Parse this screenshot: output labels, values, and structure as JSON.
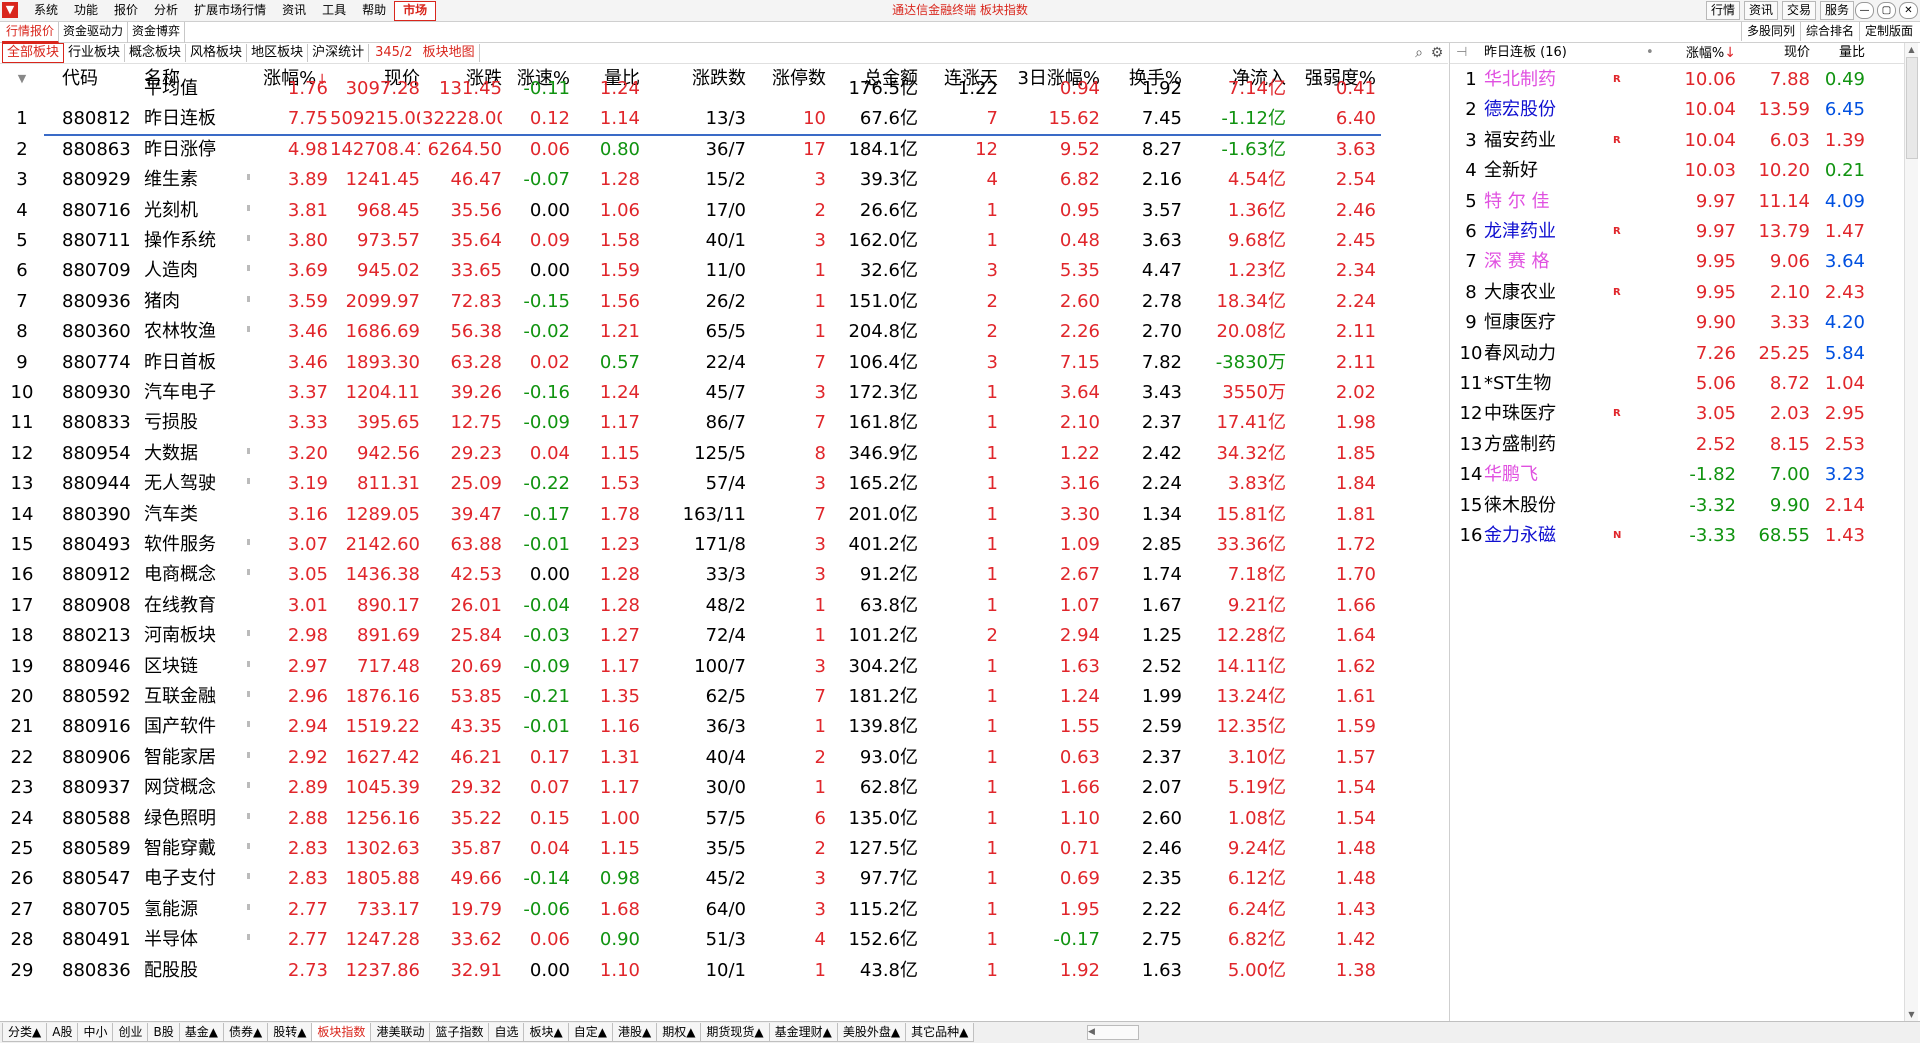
{
  "menubar": {
    "logo": "▼",
    "menus": [
      "系统",
      "功能",
      "报价",
      "分析",
      "扩展市场行情",
      "资讯",
      "工具",
      "帮助",
      "市场"
    ],
    "title": "通达信金融终端  板块指数",
    "right_buttons": [
      "行情",
      "资讯",
      "交易",
      "服务"
    ],
    "window_controls": [
      "—",
      "▢",
      "✕"
    ]
  },
  "row2": {
    "tabs": [
      "行情报价",
      "资金驱动力",
      "资金博弈"
    ],
    "right_tabs": [
      "多股同列",
      "综合排名",
      "定制版面"
    ]
  },
  "row3": {
    "tabs": [
      "全部板块",
      "行业板块",
      "概念板块",
      "风格板块",
      "地区板块",
      "沪深统计"
    ],
    "count": "345/2",
    "map_tab": "板块地图"
  },
  "table": {
    "headers": {
      "sort": "▼",
      "code": "代码",
      "name": "名称",
      "change_pct": "涨幅%",
      "sort_arrow": "↓",
      "price": "现价",
      "change": "涨跌",
      "speed": "涨速%",
      "vol_ratio": "量比",
      "up_down": "涨跌数",
      "limit_up": "涨停数",
      "amount": "总金额",
      "streak": "连涨天",
      "three_day": "3日涨幅%",
      "turnover": "换手%",
      "net_inflow": "净流入",
      "strength": "强弱度%"
    },
    "avg": {
      "name": "平均值",
      "change_pct": "1.76",
      "price": "3097.28",
      "change": "131.45",
      "speed": "-0.11",
      "vol_ratio": "1.24",
      "amount": "176.5亿",
      "streak": "1.22",
      "three_day": "0.94",
      "turnover": "1.92",
      "net_inflow": "7.14亿",
      "strength": "0.41"
    },
    "rows": [
      {
        "no": "1",
        "code": "880812",
        "name": "昨日连板",
        "change_pct": "7.75",
        "price": "509215.00",
        "change": "32228.00",
        "speed": "0.12",
        "vol_ratio": "1.14",
        "up_down": "13/3",
        "limit_up": "10",
        "amount": "67.6亿",
        "streak": "7",
        "three_day": "15.62",
        "turnover": "7.45",
        "net_inflow": "-1.12亿",
        "strength": "6.40"
      },
      {
        "no": "2",
        "code": "880863",
        "name": "昨日涨停",
        "change_pct": "4.98",
        "price": "142708.41",
        "change": "6264.50",
        "speed": "0.06",
        "vol_ratio": "0.80",
        "up_down": "36/7",
        "limit_up": "17",
        "amount": "184.1亿",
        "streak": "12",
        "three_day": "9.52",
        "turnover": "8.27",
        "net_inflow": "-1.63亿",
        "strength": "3.63"
      },
      {
        "no": "3",
        "code": "880929",
        "name": "维生素",
        "change_pct": "3.89",
        "price": "1241.45",
        "change": "46.47",
        "speed": "-0.07",
        "vol_ratio": "1.28",
        "up_down": "15/2",
        "limit_up": "3",
        "amount": "39.3亿",
        "streak": "4",
        "three_day": "6.82",
        "turnover": "2.16",
        "net_inflow": "4.54亿",
        "strength": "2.54"
      },
      {
        "no": "4",
        "code": "880716",
        "name": "光刻机",
        "change_pct": "3.81",
        "price": "968.45",
        "change": "35.56",
        "speed": "0.00",
        "vol_ratio": "1.06",
        "up_down": "17/0",
        "limit_up": "2",
        "amount": "26.6亿",
        "streak": "1",
        "three_day": "0.95",
        "turnover": "3.57",
        "net_inflow": "1.36亿",
        "strength": "2.46"
      },
      {
        "no": "5",
        "code": "880711",
        "name": "操作系统",
        "change_pct": "3.80",
        "price": "973.57",
        "change": "35.64",
        "speed": "0.09",
        "vol_ratio": "1.58",
        "up_down": "40/1",
        "limit_up": "3",
        "amount": "162.0亿",
        "streak": "1",
        "three_day": "0.48",
        "turnover": "3.63",
        "net_inflow": "9.68亿",
        "strength": "2.45"
      },
      {
        "no": "6",
        "code": "880709",
        "name": "人造肉",
        "change_pct": "3.69",
        "price": "945.02",
        "change": "33.65",
        "speed": "0.00",
        "vol_ratio": "1.59",
        "up_down": "11/0",
        "limit_up": "1",
        "amount": "32.6亿",
        "streak": "3",
        "three_day": "5.35",
        "turnover": "4.47",
        "net_inflow": "1.23亿",
        "strength": "2.34"
      },
      {
        "no": "7",
        "code": "880936",
        "name": "猪肉",
        "change_pct": "3.59",
        "price": "2099.97",
        "change": "72.83",
        "speed": "-0.15",
        "vol_ratio": "1.56",
        "up_down": "26/2",
        "limit_up": "1",
        "amount": "151.0亿",
        "streak": "2",
        "three_day": "2.60",
        "turnover": "2.78",
        "net_inflow": "18.34亿",
        "strength": "2.24"
      },
      {
        "no": "8",
        "code": "880360",
        "name": "农林牧渔",
        "change_pct": "3.46",
        "price": "1686.69",
        "change": "56.38",
        "speed": "-0.02",
        "vol_ratio": "1.21",
        "up_down": "65/5",
        "limit_up": "1",
        "amount": "204.8亿",
        "streak": "2",
        "three_day": "2.26",
        "turnover": "2.70",
        "net_inflow": "20.08亿",
        "strength": "2.11"
      },
      {
        "no": "9",
        "code": "880774",
        "name": "昨日首板",
        "change_pct": "3.46",
        "price": "1893.30",
        "change": "63.28",
        "speed": "0.02",
        "vol_ratio": "0.57",
        "up_down": "22/4",
        "limit_up": "7",
        "amount": "106.4亿",
        "streak": "3",
        "three_day": "7.15",
        "turnover": "7.82",
        "net_inflow": "-3830万",
        "strength": "2.11"
      },
      {
        "no": "10",
        "code": "880930",
        "name": "汽车电子",
        "change_pct": "3.37",
        "price": "1204.11",
        "change": "39.26",
        "speed": "-0.16",
        "vol_ratio": "1.24",
        "up_down": "45/7",
        "limit_up": "3",
        "amount": "172.3亿",
        "streak": "1",
        "three_day": "3.64",
        "turnover": "3.43",
        "net_inflow": "3550万",
        "strength": "2.02"
      },
      {
        "no": "11",
        "code": "880833",
        "name": "亏损股",
        "change_pct": "3.33",
        "price": "395.65",
        "change": "12.75",
        "speed": "-0.09",
        "vol_ratio": "1.17",
        "up_down": "86/7",
        "limit_up": "7",
        "amount": "161.8亿",
        "streak": "1",
        "three_day": "2.10",
        "turnover": "2.37",
        "net_inflow": "17.41亿",
        "strength": "1.98"
      },
      {
        "no": "12",
        "code": "880954",
        "name": "大数据",
        "change_pct": "3.20",
        "price": "942.56",
        "change": "29.23",
        "speed": "0.04",
        "vol_ratio": "1.15",
        "up_down": "125/5",
        "limit_up": "8",
        "amount": "346.9亿",
        "streak": "1",
        "three_day": "1.22",
        "turnover": "2.42",
        "net_inflow": "34.32亿",
        "strength": "1.85"
      },
      {
        "no": "13",
        "code": "880944",
        "name": "无人驾驶",
        "change_pct": "3.19",
        "price": "811.31",
        "change": "25.09",
        "speed": "-0.22",
        "vol_ratio": "1.53",
        "up_down": "57/4",
        "limit_up": "3",
        "amount": "165.2亿",
        "streak": "1",
        "three_day": "3.16",
        "turnover": "2.24",
        "net_inflow": "3.83亿",
        "strength": "1.84"
      },
      {
        "no": "14",
        "code": "880390",
        "name": "汽车类",
        "change_pct": "3.16",
        "price": "1289.05",
        "change": "39.47",
        "speed": "-0.17",
        "vol_ratio": "1.78",
        "up_down": "163/11",
        "limit_up": "7",
        "amount": "201.0亿",
        "streak": "1",
        "three_day": "3.30",
        "turnover": "1.34",
        "net_inflow": "15.81亿",
        "strength": "1.81"
      },
      {
        "no": "15",
        "code": "880493",
        "name": "软件服务",
        "change_pct": "3.07",
        "price": "2142.60",
        "change": "63.88",
        "speed": "-0.01",
        "vol_ratio": "1.23",
        "up_down": "171/8",
        "limit_up": "3",
        "amount": "401.2亿",
        "streak": "1",
        "three_day": "1.09",
        "turnover": "2.85",
        "net_inflow": "33.36亿",
        "strength": "1.72"
      },
      {
        "no": "16",
        "code": "880912",
        "name": "电商概念",
        "change_pct": "3.05",
        "price": "1436.38",
        "change": "42.53",
        "speed": "0.00",
        "vol_ratio": "1.28",
        "up_down": "33/3",
        "limit_up": "3",
        "amount": "91.2亿",
        "streak": "1",
        "three_day": "2.67",
        "turnover": "1.74",
        "net_inflow": "7.18亿",
        "strength": "1.70"
      },
      {
        "no": "17",
        "code": "880908",
        "name": "在线教育",
        "change_pct": "3.01",
        "price": "890.17",
        "change": "26.01",
        "speed": "-0.04",
        "vol_ratio": "1.28",
        "up_down": "48/2",
        "limit_up": "1",
        "amount": "63.8亿",
        "streak": "1",
        "three_day": "1.07",
        "turnover": "1.67",
        "net_inflow": "9.21亿",
        "strength": "1.66"
      },
      {
        "no": "18",
        "code": "880213",
        "name": "河南板块",
        "change_pct": "2.98",
        "price": "891.69",
        "change": "25.84",
        "speed": "-0.03",
        "vol_ratio": "1.27",
        "up_down": "72/4",
        "limit_up": "1",
        "amount": "101.2亿",
        "streak": "2",
        "three_day": "2.94",
        "turnover": "1.25",
        "net_inflow": "12.28亿",
        "strength": "1.64"
      },
      {
        "no": "19",
        "code": "880946",
        "name": "区块链",
        "change_pct": "2.97",
        "price": "717.48",
        "change": "20.69",
        "speed": "-0.09",
        "vol_ratio": "1.17",
        "up_down": "100/7",
        "limit_up": "3",
        "amount": "304.2亿",
        "streak": "1",
        "three_day": "1.63",
        "turnover": "2.52",
        "net_inflow": "14.11亿",
        "strength": "1.62"
      },
      {
        "no": "20",
        "code": "880592",
        "name": "互联金融",
        "change_pct": "2.96",
        "price": "1876.16",
        "change": "53.85",
        "speed": "-0.21",
        "vol_ratio": "1.35",
        "up_down": "62/5",
        "limit_up": "7",
        "amount": "181.2亿",
        "streak": "1",
        "three_day": "1.24",
        "turnover": "1.99",
        "net_inflow": "13.24亿",
        "strength": "1.61"
      },
      {
        "no": "21",
        "code": "880916",
        "name": "国产软件",
        "change_pct": "2.94",
        "price": "1519.22",
        "change": "43.35",
        "speed": "-0.01",
        "vol_ratio": "1.16",
        "up_down": "36/3",
        "limit_up": "1",
        "amount": "139.8亿",
        "streak": "1",
        "three_day": "1.55",
        "turnover": "2.59",
        "net_inflow": "12.35亿",
        "strength": "1.59"
      },
      {
        "no": "22",
        "code": "880906",
        "name": "智能家居",
        "change_pct": "2.92",
        "price": "1627.42",
        "change": "46.21",
        "speed": "0.17",
        "vol_ratio": "1.31",
        "up_down": "40/4",
        "limit_up": "2",
        "amount": "93.0亿",
        "streak": "1",
        "three_day": "0.63",
        "turnover": "2.37",
        "net_inflow": "3.10亿",
        "strength": "1.57"
      },
      {
        "no": "23",
        "code": "880937",
        "name": "网贷概念",
        "change_pct": "2.89",
        "price": "1045.39",
        "change": "29.32",
        "speed": "0.07",
        "vol_ratio": "1.17",
        "up_down": "30/0",
        "limit_up": "1",
        "amount": "62.8亿",
        "streak": "1",
        "three_day": "1.66",
        "turnover": "2.07",
        "net_inflow": "5.19亿",
        "strength": "1.54"
      },
      {
        "no": "24",
        "code": "880588",
        "name": "绿色照明",
        "change_pct": "2.88",
        "price": "1256.16",
        "change": "35.22",
        "speed": "0.15",
        "vol_ratio": "1.00",
        "up_down": "57/5",
        "limit_up": "6",
        "amount": "135.0亿",
        "streak": "1",
        "three_day": "1.10",
        "turnover": "2.60",
        "net_inflow": "1.08亿",
        "strength": "1.54"
      },
      {
        "no": "25",
        "code": "880589",
        "name": "智能穿戴",
        "change_pct": "2.83",
        "price": "1302.63",
        "change": "35.87",
        "speed": "0.04",
        "vol_ratio": "1.15",
        "up_down": "35/5",
        "limit_up": "2",
        "amount": "127.5亿",
        "streak": "1",
        "three_day": "0.71",
        "turnover": "2.46",
        "net_inflow": "9.24亿",
        "strength": "1.48"
      },
      {
        "no": "26",
        "code": "880547",
        "name": "电子支付",
        "change_pct": "2.83",
        "price": "1805.88",
        "change": "49.66",
        "speed": "-0.14",
        "vol_ratio": "0.98",
        "up_down": "45/2",
        "limit_up": "3",
        "amount": "97.7亿",
        "streak": "1",
        "three_day": "0.69",
        "turnover": "2.35",
        "net_inflow": "6.12亿",
        "strength": "1.48"
      },
      {
        "no": "27",
        "code": "880705",
        "name": "氢能源",
        "change_pct": "2.77",
        "price": "733.17",
        "change": "19.79",
        "speed": "-0.06",
        "vol_ratio": "1.68",
        "up_down": "64/0",
        "limit_up": "3",
        "amount": "115.2亿",
        "streak": "1",
        "three_day": "1.95",
        "turnover": "2.22",
        "net_inflow": "6.24亿",
        "strength": "1.43"
      },
      {
        "no": "28",
        "code": "880491",
        "name": "半导体",
        "change_pct": "2.77",
        "price": "1247.28",
        "change": "33.62",
        "speed": "0.06",
        "vol_ratio": "0.90",
        "up_down": "51/3",
        "limit_up": "4",
        "amount": "152.6亿",
        "streak": "1",
        "three_day": "-0.17",
        "turnover": "2.75",
        "net_inflow": "6.82亿",
        "strength": "1.42"
      },
      {
        "no": "29",
        "code": "880836",
        "name": "配股股",
        "change_pct": "2.73",
        "price": "1237.86",
        "change": "32.91",
        "speed": "0.00",
        "vol_ratio": "1.10",
        "up_down": "10/1",
        "limit_up": "1",
        "amount": "43.8亿",
        "streak": "1",
        "three_day": "1.92",
        "turnover": "1.63",
        "net_inflow": "5.00亿",
        "strength": "1.38"
      }
    ]
  },
  "right_panel": {
    "pin": "⊣",
    "title": "昨日连板 (16)",
    "headers": {
      "change_pct": "涨幅%",
      "sort_arrow": "↓",
      "price": "现价",
      "vol_ratio": "量比"
    },
    "rows": [
      {
        "no": "1",
        "name": "华北制药",
        "flag": "R",
        "change_pct": "10.06",
        "price": "7.88",
        "vol_ratio": "0.49",
        "name_color": "#e050e0",
        "vr_color": "#109310"
      },
      {
        "no": "2",
        "name": "德宏股份",
        "flag": "",
        "change_pct": "10.04",
        "price": "13.59",
        "vol_ratio": "6.45",
        "name_color": "#1010d0",
        "vr_color": "#0050e0"
      },
      {
        "no": "3",
        "name": "福安药业",
        "flag": "R",
        "change_pct": "10.04",
        "price": "6.03",
        "vol_ratio": "1.39",
        "name_color": "#000000",
        "vr_color": "#e0262b"
      },
      {
        "no": "4",
        "name": "全新好",
        "flag": "",
        "change_pct": "10.03",
        "price": "10.20",
        "vol_ratio": "0.21",
        "name_color": "#000000",
        "vr_color": "#109310"
      },
      {
        "no": "5",
        "name": "特 尔 佳",
        "flag": "",
        "change_pct": "9.97",
        "price": "11.14",
        "vol_ratio": "4.09",
        "name_color": "#e050e0",
        "vr_color": "#0050e0"
      },
      {
        "no": "6",
        "name": "龙津药业",
        "flag": "R",
        "change_pct": "9.97",
        "price": "13.79",
        "vol_ratio": "1.47",
        "name_color": "#1010d0",
        "vr_color": "#e0262b"
      },
      {
        "no": "7",
        "name": "深 赛 格",
        "flag": "",
        "change_pct": "9.95",
        "price": "9.06",
        "vol_ratio": "3.64",
        "name_color": "#e050e0",
        "vr_color": "#0050e0"
      },
      {
        "no": "8",
        "name": "大康农业",
        "flag": "R",
        "change_pct": "9.95",
        "price": "2.10",
        "vol_ratio": "2.43",
        "name_color": "#000000",
        "vr_color": "#e0262b"
      },
      {
        "no": "9",
        "name": "恒康医疗",
        "flag": "",
        "change_pct": "9.90",
        "price": "3.33",
        "vol_ratio": "4.20",
        "name_color": "#000000",
        "vr_color": "#0050e0"
      },
      {
        "no": "10",
        "name": "春风动力",
        "flag": "",
        "change_pct": "7.26",
        "price": "25.25",
        "vol_ratio": "5.84",
        "name_color": "#000000",
        "vr_color": "#0050e0"
      },
      {
        "no": "11",
        "name": "*ST生物",
        "flag": "",
        "change_pct": "5.06",
        "price": "8.72",
        "vol_ratio": "1.04",
        "name_color": "#000000",
        "vr_color": "#e0262b"
      },
      {
        "no": "12",
        "name": "中珠医疗",
        "flag": "R",
        "change_pct": "3.05",
        "price": "2.03",
        "vol_ratio": "2.95",
        "name_color": "#000000",
        "vr_color": "#e0262b"
      },
      {
        "no": "13",
        "name": "方盛制药",
        "flag": "",
        "change_pct": "2.52",
        "price": "8.15",
        "vol_ratio": "2.53",
        "name_color": "#000000",
        "vr_color": "#e0262b"
      },
      {
        "no": "14",
        "name": "华鹏飞",
        "flag": "",
        "change_pct": "-1.82",
        "price": "7.00",
        "vol_ratio": "3.23",
        "name_color": "#e050e0",
        "vr_color": "#0050e0"
      },
      {
        "no": "15",
        "name": "徕木股份",
        "flag": "",
        "change_pct": "-3.32",
        "price": "9.90",
        "vol_ratio": "2.14",
        "name_color": "#000000",
        "vr_color": "#e0262b"
      },
      {
        "no": "16",
        "name": "金力永磁",
        "flag": "N",
        "change_pct": "-3.33",
        "price": "68.55",
        "vol_ratio": "1.43",
        "name_color": "#1010d0",
        "vr_color": "#e0262b"
      }
    ]
  },
  "bottom_tabs": [
    "分类▲",
    "A股",
    "中小",
    "创业",
    "B股",
    "基金▲",
    "债券▲",
    "股转▲",
    "板块指数",
    "港美联动",
    "篮子指数",
    "自选",
    "板块▲",
    "自定▲",
    "港股▲",
    "期权▲",
    "期货现货▲",
    "基金理财▲",
    "美股外盘▲",
    "其它品种▲"
  ],
  "colors": {
    "up": "#e0262b",
    "down": "#109310",
    "accent": "#d9261c",
    "selection": "#3a6bc7"
  }
}
